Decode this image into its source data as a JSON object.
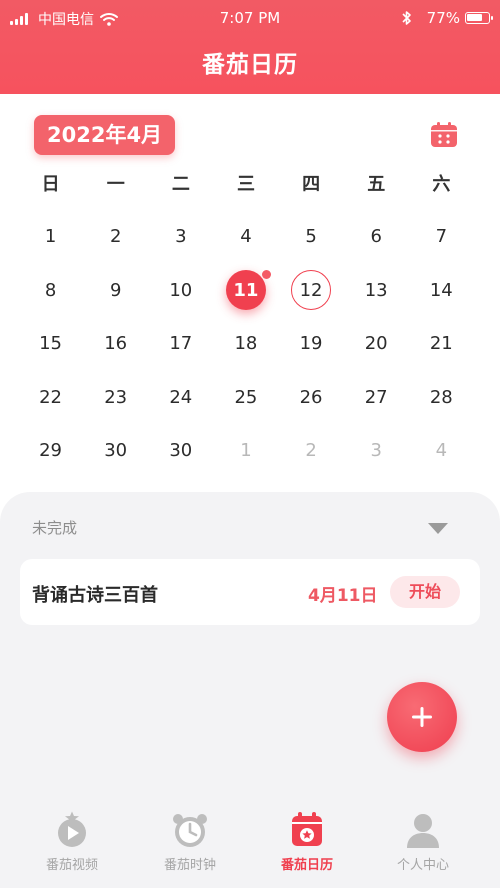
{
  "status_bar": {
    "carrier": "中国电信",
    "time": "7:07 PM",
    "battery_percent": "77%",
    "battery_level": 0.77
  },
  "header": {
    "title": "番茄日历"
  },
  "calendar": {
    "month_label": "2022年4月",
    "weekdays": [
      "日",
      "一",
      "二",
      "三",
      "四",
      "五",
      "六"
    ],
    "weeks": [
      [
        "1",
        "2",
        "3",
        "4",
        "5",
        "6",
        "7"
      ],
      [
        "8",
        "9",
        "10",
        "11",
        "12",
        "13",
        "14"
      ],
      [
        "15",
        "16",
        "17",
        "18",
        "19",
        "20",
        "21"
      ],
      [
        "22",
        "23",
        "24",
        "25",
        "26",
        "27",
        "28"
      ],
      [
        "29",
        "30",
        "30",
        "1",
        "2",
        "3",
        "4"
      ]
    ],
    "selected_day": "11",
    "today_day": "12"
  },
  "tasks": {
    "section_label": "未完成",
    "items": [
      {
        "name": "背诵古诗三百首",
        "date": "4月11日",
        "action": "开始"
      }
    ]
  },
  "tabbar": {
    "items": [
      {
        "label": "番茄视频",
        "icon": "video-star-icon"
      },
      {
        "label": "番茄时钟",
        "icon": "alarm-clock-icon"
      },
      {
        "label": "番茄日历",
        "icon": "calendar-star-icon"
      },
      {
        "label": "个人中心",
        "icon": "user-icon"
      }
    ],
    "active_index": 2
  },
  "colors": {
    "accent": "#f0404f",
    "header": "#f55660",
    "inactive": "#a5a5a5"
  }
}
